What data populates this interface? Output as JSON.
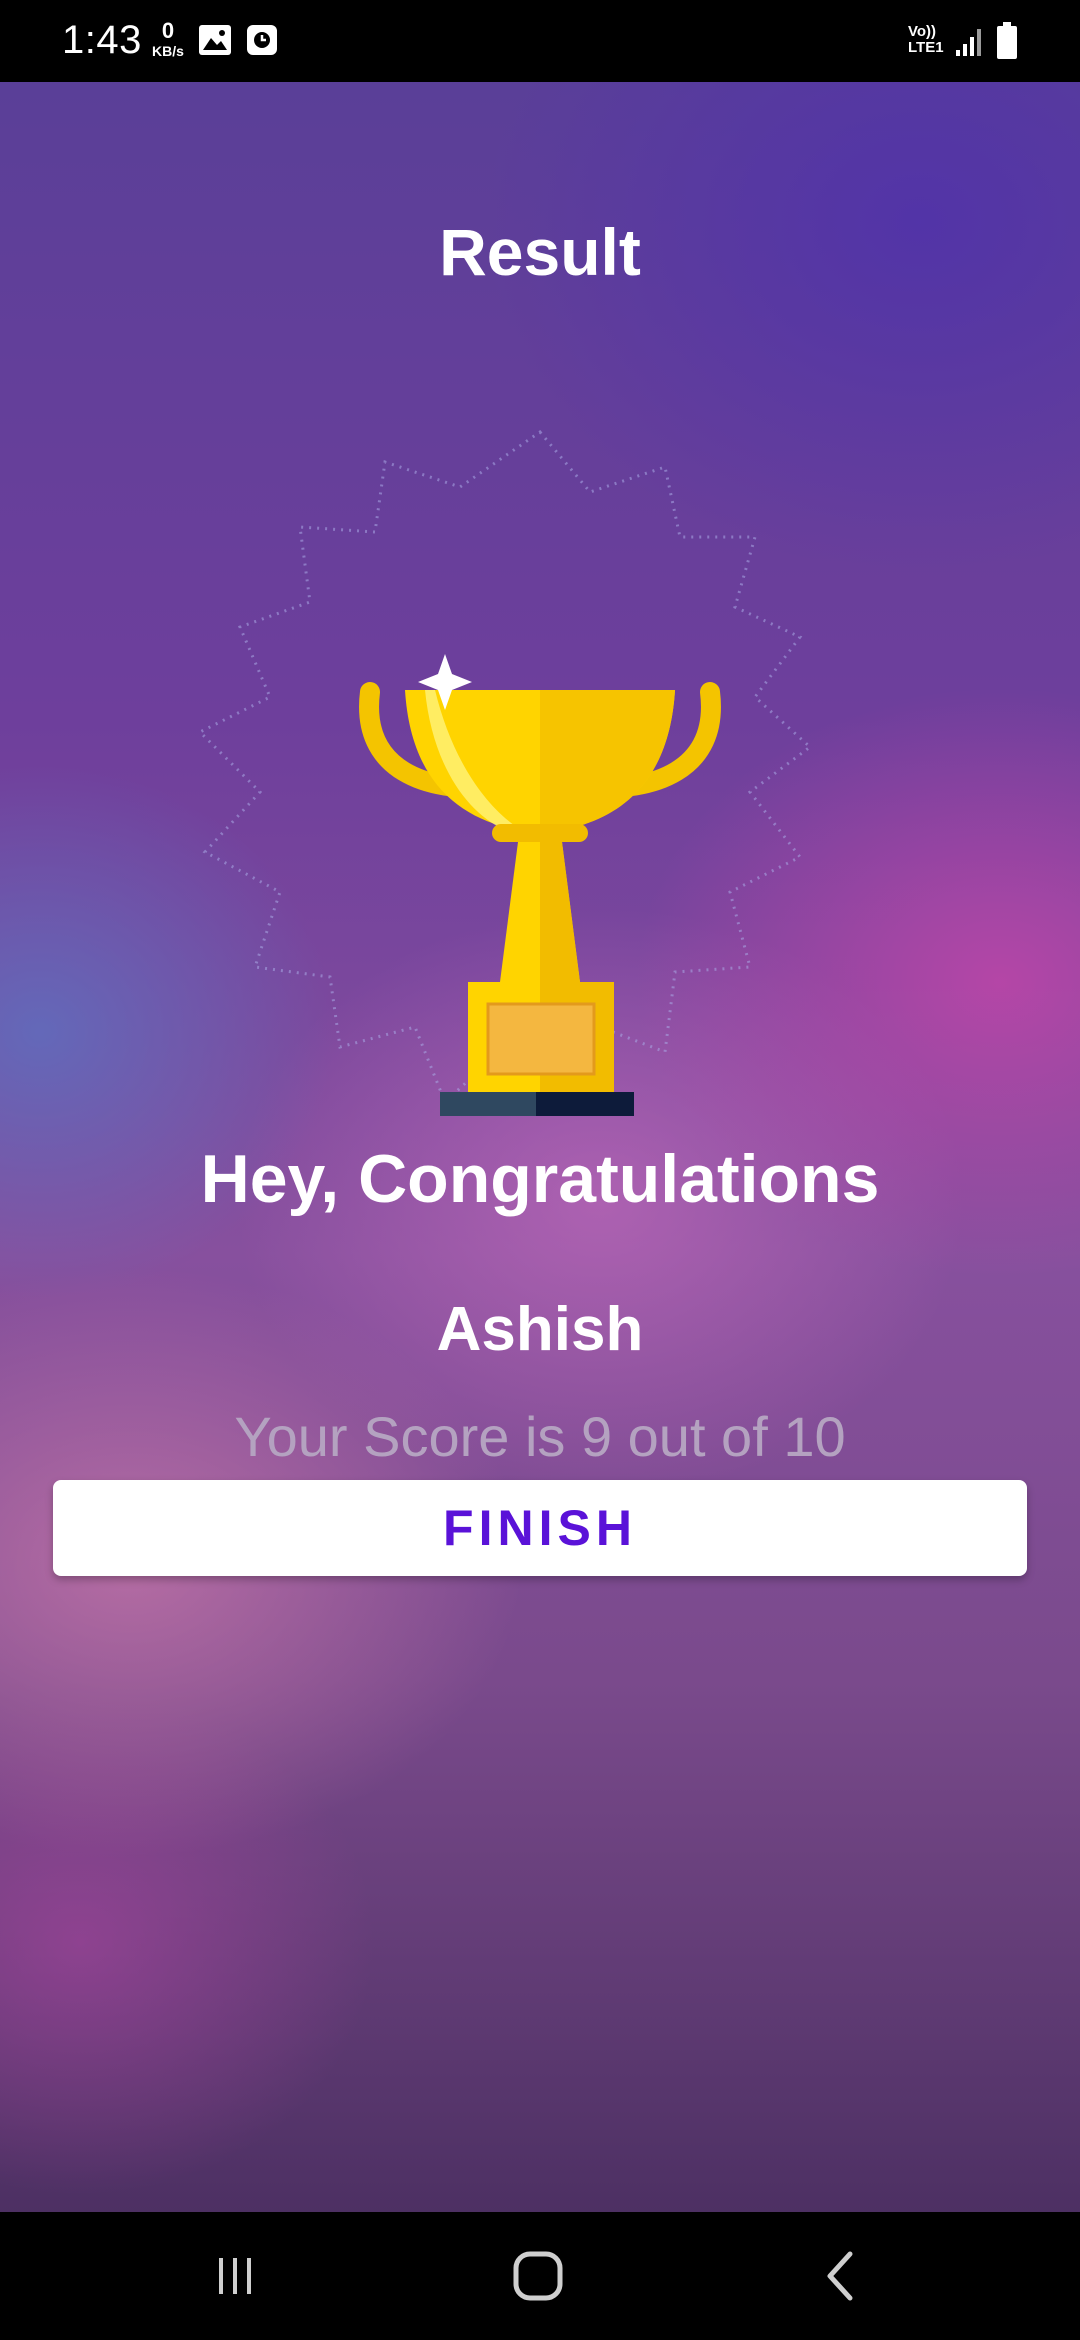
{
  "status_bar": {
    "time": "1:43",
    "net_speed_value": "0",
    "net_speed_unit": "KB/s",
    "network_label_top": "Vo))",
    "network_label_bottom": "LTE1",
    "icons": [
      "gallery-icon",
      "clock-icon",
      "signal-icon",
      "battery-icon"
    ]
  },
  "screen": {
    "title": "Result",
    "congrats_text": "Hey, Congratulations",
    "user_name": "Ashish",
    "score_text": "Your Score is 9 out of 10",
    "finish_button_label": "FINISH",
    "illustration": "trophy-icon"
  },
  "nav_bar": {
    "buttons": [
      "recents-icon",
      "home-icon",
      "back-icon"
    ]
  },
  "colors": {
    "button_text": "#5a12d8",
    "button_background": "#ffffff",
    "score_text": "#b4a2c0",
    "trophy_gold": "#ffd400"
  }
}
